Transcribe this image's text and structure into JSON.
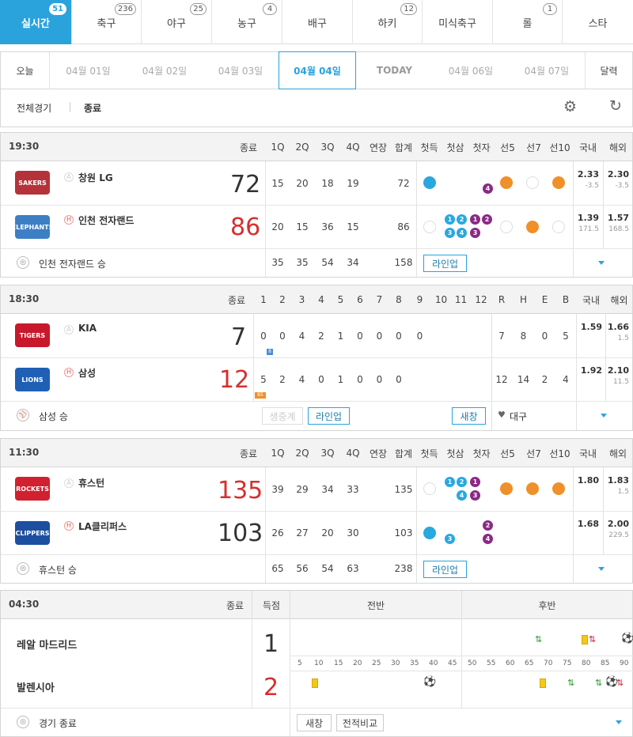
{
  "tabs": [
    {
      "label": "실시간",
      "count": "51"
    },
    {
      "label": "축구",
      "count": "236"
    },
    {
      "label": "야구",
      "count": "25"
    },
    {
      "label": "농구",
      "count": "4"
    },
    {
      "label": "배구",
      "count": ""
    },
    {
      "label": "하키",
      "count": "12"
    },
    {
      "label": "미식축구",
      "count": ""
    },
    {
      "label": "롤",
      "count": "1"
    },
    {
      "label": "스타",
      "count": ""
    }
  ],
  "dates": [
    "오늘",
    "04월 01일",
    "04월 02일",
    "04월 03일",
    "04월 04일",
    "TODAY",
    "04월 06일",
    "04월 07일",
    "달력"
  ],
  "filter": {
    "all": "전체경기",
    "finished": "종료"
  },
  "basketball_cols": [
    "1Q",
    "2Q",
    "3Q",
    "4Q",
    "연장",
    "합계",
    "첫득",
    "첫삼",
    "첫자",
    "선5",
    "선7",
    "선10",
    "국내",
    "해외"
  ],
  "baseball_cols": [
    "1",
    "2",
    "3",
    "4",
    "5",
    "6",
    "7",
    "8",
    "9",
    "10",
    "11",
    "12",
    "R",
    "H",
    "E",
    "B",
    "국내",
    "해외"
  ],
  "game1": {
    "time": "19:30",
    "status": "종료",
    "home_mark": "H",
    "t1": {
      "name": "창원 LG",
      "logo": "SAKERS",
      "score": "72",
      "q": [
        "15",
        "20",
        "18",
        "19",
        "",
        "72"
      ],
      "first_num": "4",
      "d1": "2.33",
      "d1s": "-3.5",
      "d2": "2.30",
      "d2s": "-3.5"
    },
    "t2": {
      "name": "인천 전자랜드",
      "logo": "ELEPHANTS",
      "score": "86",
      "q": [
        "20",
        "15",
        "36",
        "15",
        "",
        "86"
      ],
      "nums": [
        "1",
        "2",
        "1",
        "2",
        "3",
        "4",
        "3"
      ],
      "d1": "1.39",
      "d1s": "171.5",
      "d2": "1.57",
      "d2s": "168.5"
    },
    "totals": [
      "35",
      "35",
      "54",
      "34",
      "",
      "158"
    ],
    "result": "인천 전자랜드 승",
    "lineup": "라인업"
  },
  "game2": {
    "time": "18:30",
    "status": "종료",
    "t1": {
      "name": "KIA",
      "logo": "TIGERS",
      "score": "7",
      "inn": [
        "0",
        "0",
        "4",
        "2",
        "1",
        "0",
        "0",
        "0",
        "0",
        "",
        "",
        ""
      ],
      "rheb": [
        "7",
        "8",
        "0",
        "5"
      ],
      "mini": "8",
      "d1": "1.59",
      "d2": "1.66",
      "d2s": "1.5"
    },
    "t2": {
      "name": "삼성",
      "logo": "LIONS",
      "score": "12",
      "inn": [
        "5",
        "2",
        "4",
        "0",
        "1",
        "0",
        "0",
        "0",
        "",
        "",
        "",
        ""
      ],
      "rheb": [
        "12",
        "14",
        "2",
        "4"
      ],
      "mini": "85",
      "d1": "1.92",
      "d2": "2.10",
      "d2s": "11.5"
    },
    "result": "삼성 승",
    "broadcast": "생중계",
    "lineup": "라인업",
    "window": "새창",
    "venue": "대구"
  },
  "game3": {
    "time": "11:30",
    "status": "종료",
    "t1": {
      "name": "휴스턴",
      "logo": "ROCKETS",
      "score": "135",
      "q": [
        "39",
        "29",
        "34",
        "33",
        "",
        "135"
      ],
      "nums": [
        "1",
        "2",
        "1",
        "4",
        "3",
        "3"
      ],
      "d1": "1.80",
      "d2": "1.83",
      "d2s": "1.5"
    },
    "t2": {
      "name": "LA클리퍼스",
      "logo": "CLIPPERS",
      "score": "103",
      "q": [
        "26",
        "27",
        "20",
        "30",
        "",
        "103"
      ],
      "nums": [
        "3",
        "2",
        "4"
      ],
      "d1": "1.68",
      "d2": "2.00",
      "d2s": "229.5"
    },
    "totals": [
      "65",
      "56",
      "54",
      "63",
      "",
      "238"
    ],
    "result": "휴스턴 승",
    "lineup": "라인업"
  },
  "game4": {
    "time": "04:30",
    "status": "종료",
    "score_hdr": "득점",
    "first_half": "전반",
    "second_half": "후반",
    "t1": {
      "name": "레알 마드리드",
      "score": "1"
    },
    "t2": {
      "name": "발렌시아",
      "score": "2"
    },
    "minutes": [
      "5",
      "10",
      "15",
      "20",
      "25",
      "30",
      "35",
      "40",
      "45",
      "50",
      "55",
      "60",
      "65",
      "70",
      "75",
      "80",
      "85",
      "90"
    ],
    "result": "경기 종료",
    "window": "새창",
    "compare": "전적비교"
  },
  "colors": {
    "accent": "#2aa3dd",
    "red": "#d62f2f",
    "orange": "#f0902a",
    "purple": "#8a2a85"
  }
}
